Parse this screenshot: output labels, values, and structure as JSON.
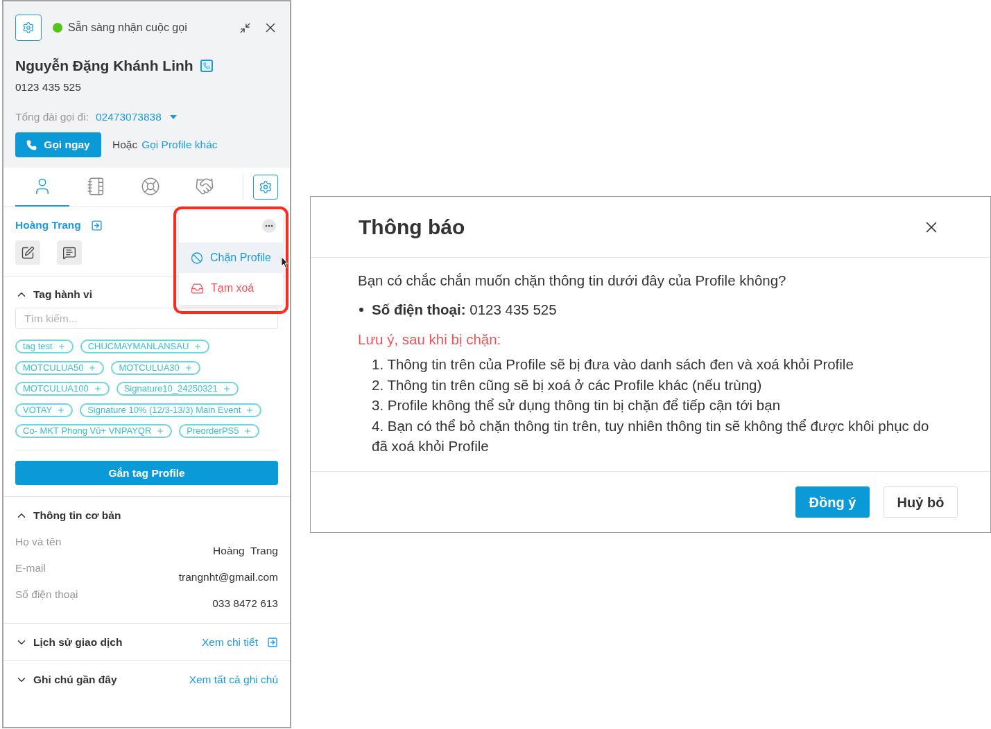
{
  "call_panel": {
    "status": {
      "text": "Sẵn sàng nhận cuộc gọi",
      "color": "#52c41a"
    },
    "contact": {
      "name": "Nguyễn Đặng Khánh Linh",
      "phone": "0123 435 525"
    },
    "outbound": {
      "label": "Tổng đài gọi đi:",
      "value": "02473073838"
    },
    "call_button": "Gọi ngay",
    "alt_text": "Hoặc",
    "alt_link": "Gọi Profile khác"
  },
  "tabs": [
    {
      "kind": "person",
      "selected": true
    },
    {
      "kind": "notebook",
      "selected": false
    },
    {
      "kind": "lifebuoy",
      "selected": false
    },
    {
      "kind": "handshake",
      "selected": false
    }
  ],
  "profile": {
    "name": "Hoàng Trang"
  },
  "profile_menu": {
    "items": [
      {
        "kind": "block",
        "label": "Chặn Profile",
        "selected": true
      },
      {
        "kind": "delete",
        "label": "Tạm xoá",
        "selected": false
      }
    ]
  },
  "tag_section": {
    "title": "Tag hành vi",
    "expanded": true,
    "search": {
      "placeholder": "Tìm kiếm..."
    },
    "tags": [
      "tag test",
      "CHUCMAYMANLANSAU",
      "MOTCULUA50",
      "MOTCULUA30",
      "MOTCULUA100",
      "Signature10_24250321",
      "VOTAY",
      "Signature 10% (12/3-13/3) Main Event",
      "Co- MKT Phong Vũ+ VNPAYQR",
      "PreorderPS5"
    ],
    "button": "Gắn tag Profile"
  },
  "basic_info": {
    "title": "Thông tin cơ bản",
    "expanded": true,
    "fields": [
      {
        "label": "Họ và tên",
        "value": "Hoàng  Trang"
      },
      {
        "label": "E-mail",
        "value": "trangnht@gmail.com"
      },
      {
        "label": "Số điện thoại",
        "value": "033 8472 613"
      }
    ]
  },
  "sections": [
    {
      "title": "Lịch sử giao dịch",
      "expanded": false,
      "link": "Xem chi tiết",
      "link_icon": true
    },
    {
      "title": "Ghi chú gần đây",
      "expanded": false,
      "link": "Xem tất cả ghi chú",
      "link_icon": false
    }
  ],
  "dialog": {
    "title": "Thông báo",
    "question": "Bạn có chắc chắn muốn chặn thông tin dưới đây của Profile không?",
    "details": [
      "**Số điện thoại:** 0123 435 525"
    ],
    "warning": "Lưu ý, sau khi bị chặn:",
    "notes": [
      "1. Thông tin trên của Profile sẽ bị đưa vào danh sách đen và xoá khỏi Profile",
      "2. Thông tin trên cũng sẽ bị xoá ở các Profile khác (nếu trùng)",
      "3. Profile không thể sử dụng thông tin bị chặn để tiếp cận tới bạn",
      "4. Bạn có thể bỏ chặn thông tin trên, tuy nhiên thông tin sẽ không thể được khôi phục do đã xoá khỏi Profile"
    ],
    "buttons": [
      {
        "kind": "primary",
        "label": "Đồng ý"
      },
      {
        "kind": "secondary",
        "label": "Huỷ bỏ"
      }
    ]
  }
}
